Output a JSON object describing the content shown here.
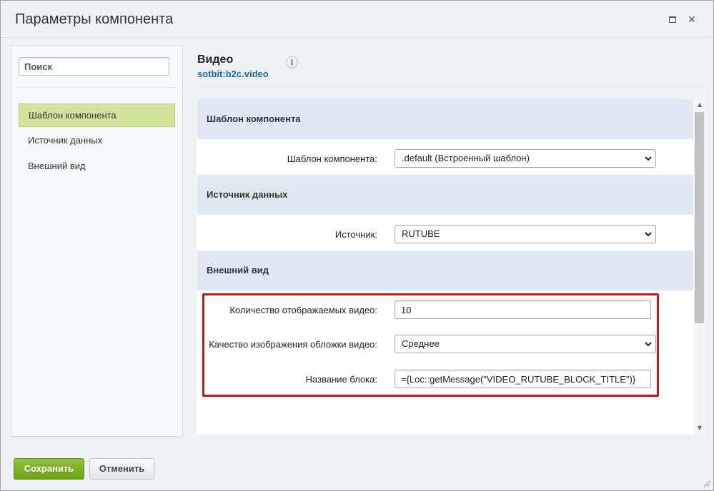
{
  "window": {
    "title": "Параметры компонента",
    "maximize_icon": "maximize-icon",
    "close_icon": "close-icon",
    "close_glyph": "✕"
  },
  "sidebar": {
    "search_placeholder": "Поиск",
    "items": [
      {
        "label": "Шаблон компонента",
        "active": true
      },
      {
        "label": "Источник данных",
        "active": false
      },
      {
        "label": "Внешний вид",
        "active": false
      }
    ]
  },
  "component": {
    "title": "Видео",
    "code": "sotbit:b2c.video",
    "info_glyph": "i"
  },
  "sections": {
    "template": {
      "title": "Шаблон компонента",
      "field_label": "Шаблон компонента:",
      "field_value": ".default (Встроенный шаблон)"
    },
    "source": {
      "title": "Источник данных",
      "field_label": "Источник:",
      "field_value": "RUTUBE"
    },
    "appearance": {
      "title": "Внешний вид",
      "count_label": "Количество отображаемых видео:",
      "count_value": "10",
      "quality_label": "Качество изображения обложки видео:",
      "quality_value": "Среднее",
      "block_title_label": "Название блока:",
      "block_title_value": "={Loc::getMessage(\"VIDEO_RUTUBE_BLOCK_TITLE\")}"
    }
  },
  "footer": {
    "save_label": "Сохранить",
    "cancel_label": "Отменить"
  },
  "colors": {
    "accent_green": "#6da317",
    "active_item": "#d2e39b",
    "section_bg": "#dee9f4",
    "highlight_border": "#c0191e",
    "link_blue": "#1b6aa8"
  }
}
